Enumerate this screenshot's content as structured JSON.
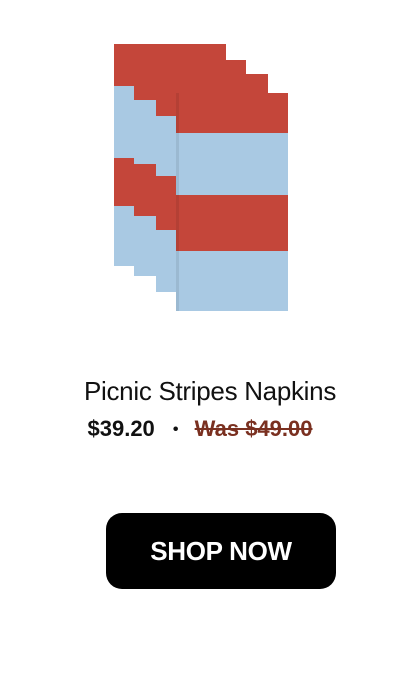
{
  "product": {
    "image_icon": "striped-napkins-image",
    "title": "Picnic Stripes Napkins",
    "price": "$39.20",
    "separator": "•",
    "was_price": "Was $49.00"
  },
  "cta": {
    "label": "SHOP NOW"
  },
  "colors": {
    "stripe_red": "#c4463a",
    "stripe_blue": "#a9c9e3",
    "was_price": "#7a3020",
    "button_bg": "#000000",
    "button_text": "#ffffff"
  }
}
